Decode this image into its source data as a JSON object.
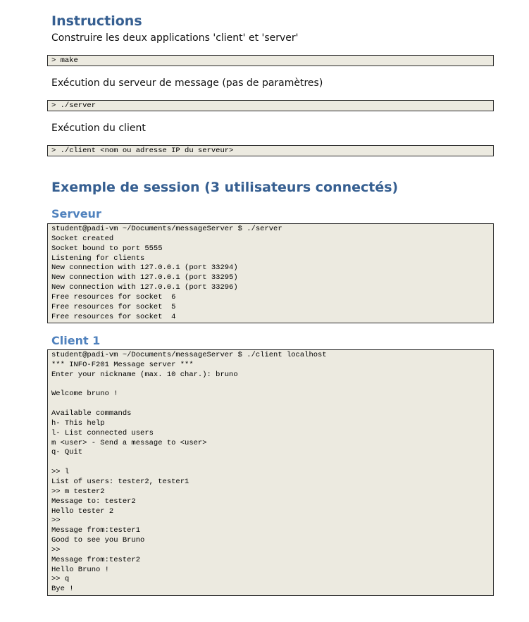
{
  "instructions": {
    "heading": "Instructions",
    "build_text": "Construire les deux applications 'client' et 'server'",
    "build_cmd": "> make",
    "server_text": "Exécution du serveur de message (pas de paramètres)",
    "server_cmd": "> ./server",
    "client_text": "Exécution du client",
    "client_cmd": "> ./client <nom ou adresse IP du serveur>"
  },
  "session": {
    "heading": "Exemple de session (3 utilisateurs connectés)",
    "server": {
      "title": "Serveur",
      "lines": [
        "student@padi-vm ~/Documents/messageServer $ ./server",
        "Socket created",
        "Socket bound to port 5555",
        "Listening for clients",
        "New connection with 127.0.0.1 (port 33294)",
        "New connection with 127.0.0.1 (port 33295)",
        "New connection with 127.0.0.1 (port 33296)",
        "Free resources for socket  6",
        "Free resources for socket  5",
        "Free resources for socket  4"
      ]
    },
    "client1": {
      "title": "Client 1",
      "lines": [
        "student@padi-vm ~/Documents/messageServer $ ./client localhost",
        "*** INFO-F201 Message server ***",
        "Enter your nickname (max. 10 char.): bruno",
        "",
        "Welcome bruno !",
        "",
        "Available commands",
        "h- This help",
        "l- List connected users",
        "m <user> - Send a message to <user>",
        "q- Quit",
        "",
        ">> l",
        "List of users: tester2, tester1",
        ">> m tester2",
        "Message to: tester2",
        "Hello tester 2",
        ">>",
        "Message from:tester1",
        "Good to see you Bruno",
        ">>",
        "Message from:tester2",
        "Hello Bruno !",
        ">> q",
        "Bye !"
      ]
    }
  }
}
